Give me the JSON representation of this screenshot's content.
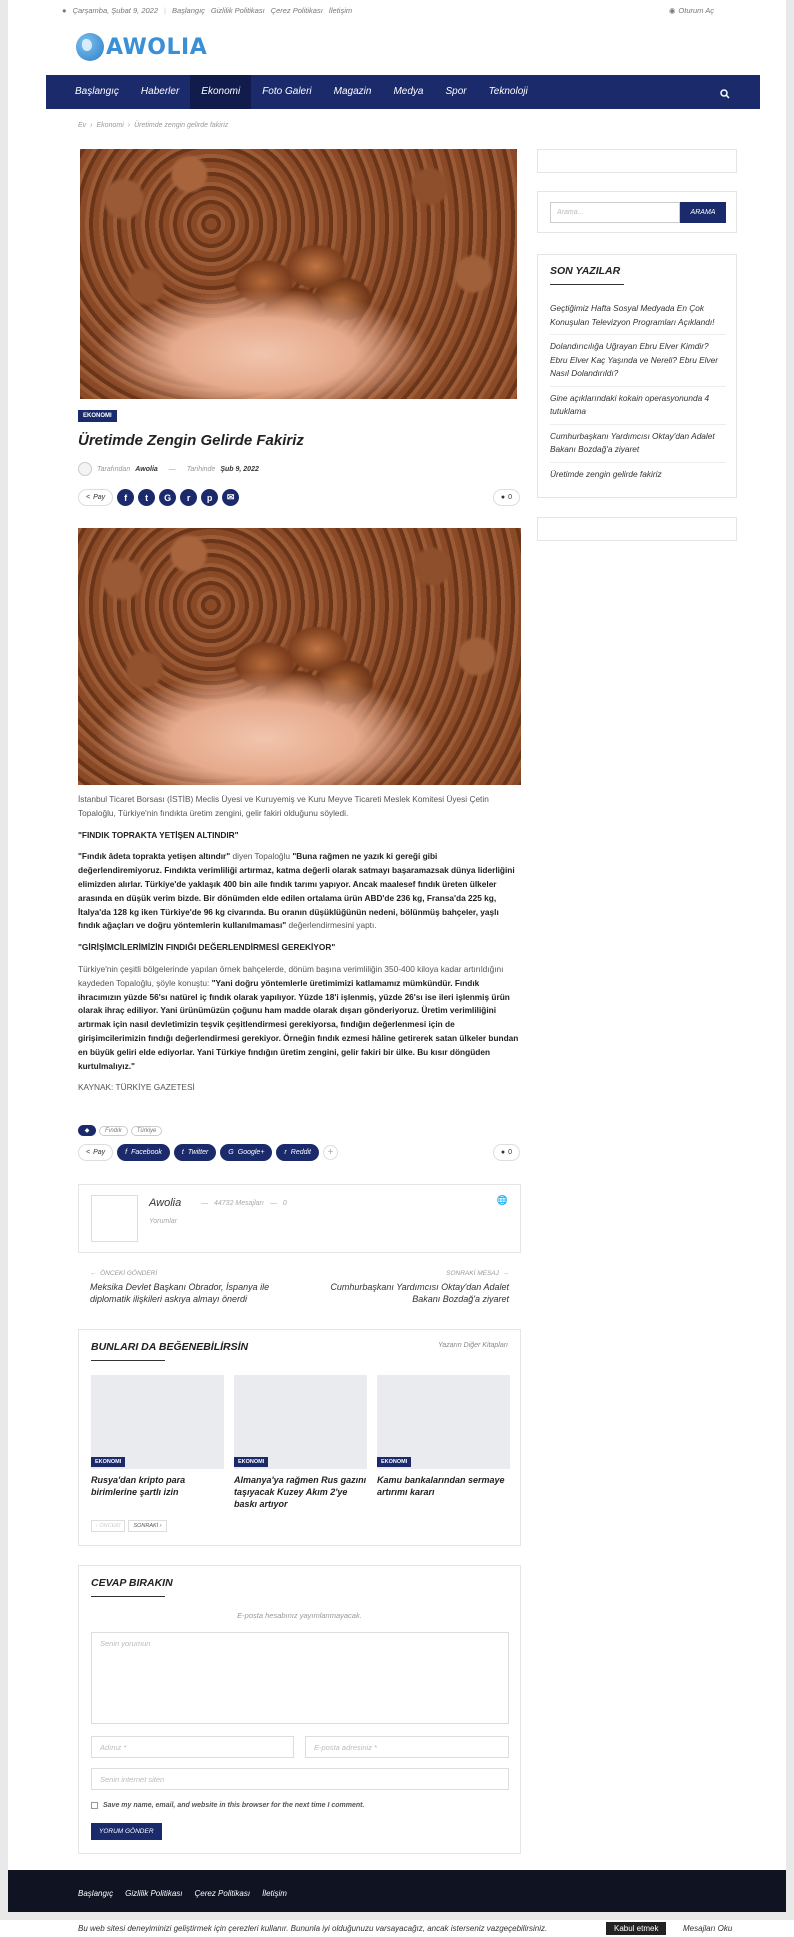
{
  "topbar": {
    "date": "Çarşamba, Şubat 9, 2022",
    "links": [
      "Başlangıç",
      "Gizlilik Politikası",
      "Çerez Politikası",
      "İletişim"
    ],
    "login": "Oturum Aç"
  },
  "logo": {
    "text": "AWOLIA"
  },
  "nav": {
    "items": [
      "Başlangıç",
      "Haberler",
      "Ekonomi",
      "Foto Galeri",
      "Magazin",
      "Medya",
      "Spor",
      "Teknoloji"
    ],
    "active": "Ekonomi"
  },
  "breadcrumb": [
    "Ev",
    "Ekonomi",
    "Üretimde zengin gelirde fakiriz"
  ],
  "article": {
    "category": "EKONOMI",
    "title": "Üretimde Zengin Gelirde Fakiriz",
    "by_label": "Tarafından",
    "author": "Awolia",
    "date_label": "Tarihinde",
    "date": "Şub 9, 2022",
    "share_label": "Pay",
    "comments": "0",
    "intro": "İstanbul Ticaret Borsası (İSTİB) Meclis Üyesi ve Kuruyemiş ve Kuru Meyve Ticareti Meslek Komitesi Üyesi Çetin Topaloğlu, Türkiye'nin fındıkta üretim zengini, gelir fakiri olduğunu söyledi.",
    "h1": "\"FINDIK TOPRAKTA YETİŞEN ALTINDIR\"",
    "p1a": "\"Fındık âdeta toprakta yetişen altındır\"",
    "p1b": " diyen Topaloğlu ",
    "p1c": "\"Buna rağmen ne yazık ki gereği gibi değerlendiremiyoruz. Fındıkta verimliliği artırmaz, katma değerli olarak satmayı başaramazsak dünya liderliğini elimizden alırlar. Türkiye'de yaklaşık 400 bin aile fındık tarımı yapıyor. Ancak maalesef fındık üreten ülkeler arasında en düşük verim bizde. Bir dönümden elde edilen ortalama ürün ABD'de 236 kg, Fransa'da 225 kg, İtalya'da 128 kg iken Türkiye'de 96 kg civarında. Bu oranın düşüklüğünün nedeni, bölünmüş bahçeler, yaşlı fındık ağaçları ve doğru yöntemlerin kullanılmaması\"",
    "p1d": " değerlendirmesini yaptı.",
    "h2": "\"GİRİŞİMCİLERİMİZİN FINDIĞI DEĞERLENDİRMESİ GEREKİYOR\"",
    "p2a": "Türkiye'nin çeşitli bölgelerinde yapılan örnek bahçelerde, dönüm başına verimliliğin 350-400 kiloya kadar artırıldığını kaydeden Topaloğlu, şöyle konuştu: ",
    "p2b": "\"Yani doğru yöntemlerle üretimimizi katlamamız mümkündür. Fındık ihracımızın yüzde 56'sı natürel iç fındık olarak yapılıyor. Yüzde 18'i işlenmiş, yüzde 26'sı ise ileri işlenmiş ürün olarak ihraç ediliyor. Yani ürünümüzün çoğunu ham madde olarak dışarı gönderiyoruz. Üretim verimliliğini artırmak için nasıl devletimizin teşvik çeşitlendirmesi gerekiyorsa, fındığın değerlenmesi için de girişimcilerimizin fındığı değerlendirmesi gerekiyor. Örneğin fındık ezmesi hâline getirerek satan ülkeler bundan en büyük geliri elde ediyorlar. Yani Türkiye fındığın üretim zengini, gelir fakiri bir ülke. Bu kısır döngüden kurtulmalıyız.\"",
    "source": "KAYNAK: TÜRKİYE GAZETESİ",
    "tags": [
      "Fındık",
      "Türkiye"
    ],
    "share_buttons": [
      "Facebook",
      "Twitter",
      "Google+",
      "Reddit"
    ]
  },
  "author_box": {
    "name": "Awolia",
    "posts": "44732 Mesajları",
    "zero": "0",
    "comments_label": "Yorumlar"
  },
  "post_nav": {
    "prev_label": "ÖNCEKİ GÖNDERİ",
    "prev_title": "Meksika Devlet Başkanı Obrador, İspanya ile diplomatik ilişkileri askıya almayı önerdi",
    "next_label": "SONRAKİ MESAJ",
    "next_title": "Cumhurbaşkanı Yardımcısı Oktay'dan Adalet Bakanı Bozdağ'a ziyaret"
  },
  "related": {
    "title": "BUNLARI DA BEĞENEBİLİRSİN",
    "more": "Yazarın Diğer Kitapları",
    "items": [
      {
        "cat": "EKONOMI",
        "title": "Rusya'dan kripto para birimlerine şartlı izin"
      },
      {
        "cat": "EKONOMI",
        "title": "Almanya'ya rağmen Rus gazını taşıyacak Kuzey Akım 2'ye baskı artıyor"
      },
      {
        "cat": "EKONOMI",
        "title": "Kamu bankalarından sermaye artırımı kararı"
      }
    ],
    "prev": "‹ ÖNCEKİ",
    "next": "SONRAKİ ›"
  },
  "reply": {
    "title": "CEVAP BIRAKIN",
    "note": "E-posta hesabınız yayımlanmayacak.",
    "comment_ph": "Senin yorumun",
    "name_ph": "Adınız *",
    "email_ph": "E-posta adresiniz *",
    "site_ph": "Senin internet siten",
    "save_label": "Save my name, email, and website in this browser for the next time I comment.",
    "submit": "YORUM GÖNDER"
  },
  "sidebar": {
    "search_ph": "Arama...",
    "search_btn": "ARAMA",
    "recent_title": "SON YAZILAR",
    "recent": [
      "Geçtiğimiz Hafta Sosyal Medyada En Çok Konuşulan Televizyon Programları Açıklandı!",
      "Dolandırıcılığa Uğrayan Ebru Elver Kimdir? Ebru Elver Kaç Yaşında ve Nereli? Ebru Elver Nasıl Dolandırıldı?",
      "Gine açıklarındaki kokain operasyonunda 4 tutuklama",
      "Cumhurbaşkanı Yardımcısı Oktay'dan Adalet Bakanı Bozdağ'a ziyaret",
      "Üretimde zengin gelirde fakiriz"
    ]
  },
  "footer": {
    "links": [
      "Başlangıç",
      "Gizlilik Politikası",
      "Çerez Politikası",
      "İletişim"
    ]
  },
  "cookie": {
    "message": "Bu web sitesi deneyiminizi geliştirmek için çerezleri kullanır. Bununla iyi olduğunuzu varsayacağız, ancak isterseniz vazgeçebilirsiniz.",
    "accept": "Kabul etmek",
    "read": "Mesajları Oku"
  },
  "colors": {
    "brand": "#1b2a6b",
    "logo": "#3b8fd5",
    "footer": "#0f1322"
  }
}
